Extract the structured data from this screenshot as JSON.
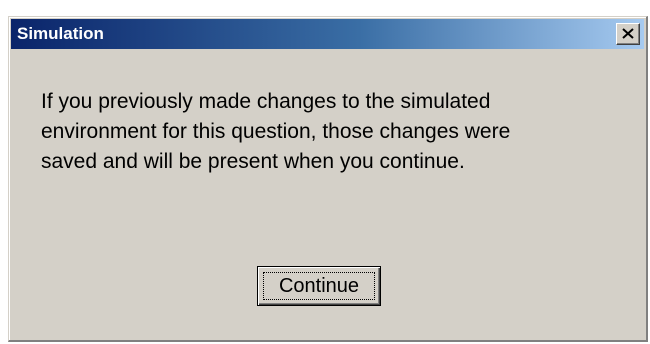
{
  "window": {
    "title": "Simulation",
    "close_icon": "close-icon"
  },
  "message": {
    "line1": "If you previously made changes to the simulated",
    "line2": "environment for this question, those changes were",
    "line3": "saved and will be present when you continue."
  },
  "buttons": {
    "continue_label": "Continue"
  },
  "colors": {
    "titlebar_start": "#0a246a",
    "titlebar_end": "#a6caf0",
    "dialog_face": "#d4d0c8"
  }
}
